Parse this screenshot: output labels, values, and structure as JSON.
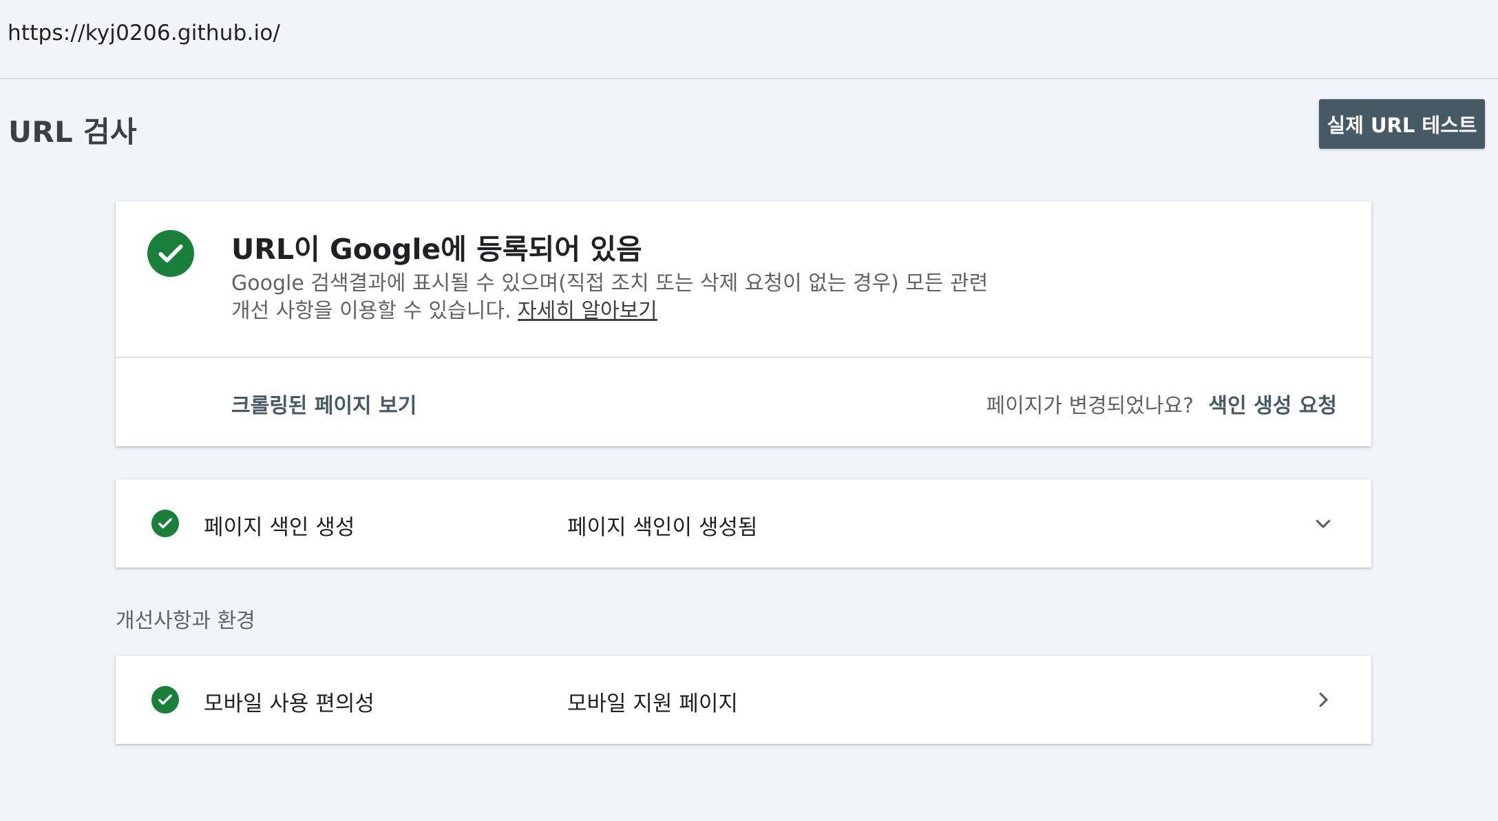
{
  "address_bar": {
    "url": "https://kyj0206.github.io/"
  },
  "header": {
    "title": "URL 검사",
    "test_button_label": "실제 URL 테스트"
  },
  "status_card": {
    "icon": "check-circle-icon",
    "headline": "URL이 Google에 등록되어 있음",
    "description": "Google 검색결과에 표시될 수 있으며(직접 조치 또는 삭제 요청이 없는 경우) 모든 관련 개선 사항을 이용할 수 있습니다.",
    "learn_more": "자세히 알아보기",
    "crawled_page_link": "크롤링된 페이지 보기",
    "changed_question": "페이지가 변경되었나요?",
    "request_indexing": "색인 생성 요청"
  },
  "indexing_row": {
    "icon": "check-circle-icon",
    "label": "페이지 색인 생성",
    "value": "페이지 색인이 생성됨",
    "arrow_icon": "chevron-down-icon"
  },
  "enhancements": {
    "heading": "개선사항과 환경",
    "items": [
      {
        "icon": "check-circle-icon",
        "label": "모바일 사용 편의성",
        "value": "모바일 지원 페이지",
        "arrow_icon": "chevron-right-icon"
      }
    ]
  },
  "colors": {
    "success": "#188038",
    "button": "#455a64",
    "background": "#f1f4f9"
  }
}
